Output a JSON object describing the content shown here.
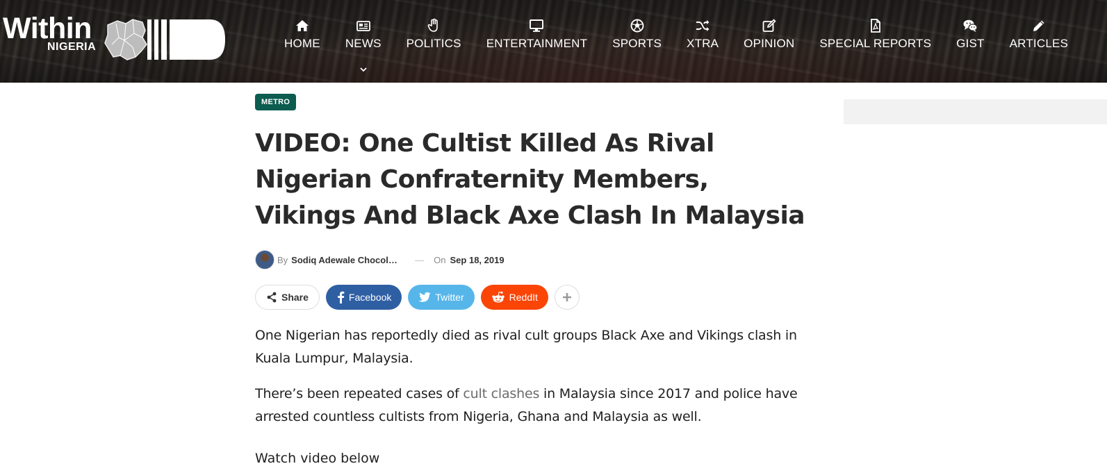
{
  "site": {
    "logo_word": "Within",
    "logo_sub": "NIGERIA"
  },
  "nav": {
    "items": [
      {
        "label": "HOME",
        "icon": "home-icon"
      },
      {
        "label": "NEWS",
        "icon": "newspaper-icon"
      },
      {
        "label": "POLITICS",
        "icon": "hand-icon"
      },
      {
        "label": "ENTERTAINMENT",
        "icon": "monitor-icon"
      },
      {
        "label": "SPORTS",
        "icon": "soccer-ball-icon"
      },
      {
        "label": "XTRA",
        "icon": "shuffle-icon"
      },
      {
        "label": "OPINION",
        "icon": "edit-icon"
      },
      {
        "label": "SPECIAL REPORTS",
        "icon": "pdf-file-icon"
      },
      {
        "label": "GIST",
        "icon": "chat-icon"
      },
      {
        "label": "ARTICLES",
        "icon": "pencil-icon"
      }
    ]
  },
  "article": {
    "category": "METRO",
    "title": "VIDEO: One Cultist Killed As Rival Nigerian Confraternity Members, Vikings And Black Axe Clash In Malaysia",
    "meta": {
      "by": "By",
      "author": "Sodiq Adewale Chocolate",
      "on": "On",
      "date": "Sep 18, 2019"
    },
    "share": {
      "share_label": "Share",
      "facebook": "Facebook",
      "twitter": "Twitter",
      "reddit": "ReddIt"
    },
    "paragraph1": "One Nigerian has reportedly died as rival cult groups Black Axe and Vikings clash in Kuala Lumpur, Malaysia.",
    "paragraph2_before": "There’s been repeated cases of ",
    "paragraph2_link": "cult clashes",
    "paragraph2_after": " in Malaysia since 2017 and police have arrested countless cultists from Nigeria, Ghana and Malaysia as well.",
    "paragraph3_partial": "Watch video below"
  },
  "colors": {
    "category_badge": "#0c5c50",
    "facebook": "#2f5fa3",
    "twitter": "#56b6ea",
    "reddit": "#fa4507"
  }
}
